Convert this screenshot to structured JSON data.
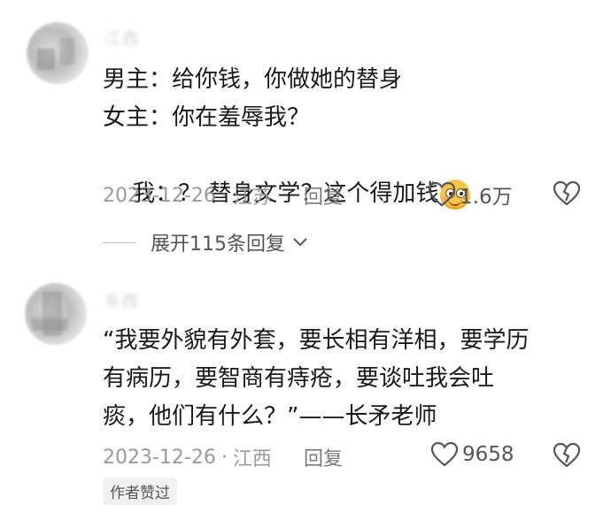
{
  "comments": [
    {
      "username": "江西",
      "lines": [
        "男主：给你钱，你做她的替身",
        "女主：你在羞辱我？",
        "我：？ 替身文学？这个得加钱"
      ],
      "date": "2023-12-26",
      "location": "江苏",
      "reply_label": "回复",
      "likes": "1.6万",
      "emoji": "smiling-face-emoji"
    },
    {
      "username": "东西",
      "lines": [
        "“我要外貌有外套，要长相有洋相，要学历",
        "有病历，要智商有痔疮，要谈吐我会吐",
        "痰，他们有什么？”——长矛老师"
      ],
      "date": "2023-12-26",
      "location": "江西",
      "reply_label": "回复",
      "likes": "9658",
      "badge": "作者赞过"
    }
  ],
  "expand_replies": "展开115条回复",
  "colors": {
    "text": "#1a1a1a",
    "meta": "#9a9a9a",
    "icon": "#555555"
  }
}
